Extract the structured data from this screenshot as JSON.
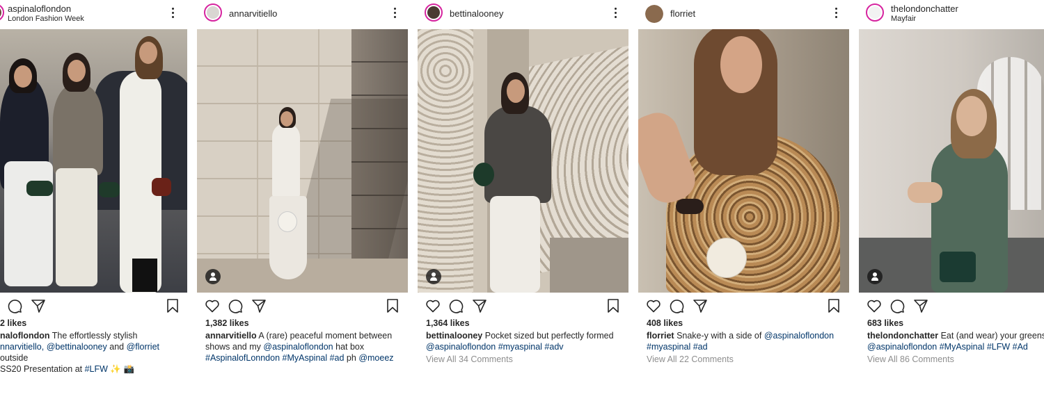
{
  "posts": [
    {
      "username": "aspinaloflondon",
      "location": "London Fashion Week",
      "likes": "2 likes",
      "caption_user": "naloflondon",
      "caption_parts": [
        {
          "t": " The effortlessly stylish",
          "link": false
        },
        {
          "t": "nnarvitiello, @bettinalooney",
          "link": true
        },
        {
          "t": " and ",
          "link": false
        },
        {
          "t": "@florriet",
          "link": true
        },
        {
          "t": " outside",
          "link": false
        },
        {
          "t": "SS20 Presentation at ",
          "link": false
        },
        {
          "t": "#LFW",
          "link": true
        },
        {
          "t": " ✨ 📸",
          "link": false
        }
      ],
      "comments": ""
    },
    {
      "username": "annarvitiello",
      "location": "",
      "likes": "1,382 likes",
      "caption_user": "annarvitiello",
      "caption_parts": [
        {
          "t": " A (rare) peaceful moment between shows and my ",
          "link": false
        },
        {
          "t": "@aspinaloflondon",
          "link": true
        },
        {
          "t": " hat box ",
          "link": false
        },
        {
          "t": "#AspinalofLonndon #MyAspinal #ad",
          "link": true
        },
        {
          "t": " ph ",
          "link": false
        },
        {
          "t": "@moeez",
          "link": true
        }
      ],
      "comments": ""
    },
    {
      "username": "bettinalooney",
      "location": "",
      "likes": "1,364 likes",
      "caption_user": "bettinalooney",
      "caption_parts": [
        {
          "t": " Pocket sized but perfectly formed ",
          "link": false
        },
        {
          "t": "@aspinaloflondon #myaspinal #adv",
          "link": true
        }
      ],
      "comments": "View All 34 Comments"
    },
    {
      "username": "florriet",
      "location": "",
      "likes": "408 likes",
      "caption_user": "florriet",
      "caption_parts": [
        {
          "t": " Snake-y with a side of ",
          "link": false
        },
        {
          "t": "@aspinaloflondon #myaspinal #ad",
          "link": true
        }
      ],
      "comments": "View All 22 Comments"
    },
    {
      "username": "thelondonchatter",
      "location": "Mayfair",
      "likes": "683 likes",
      "caption_user": "thelondonchatter",
      "caption_parts": [
        {
          "t": " Eat (and wear) your greens, kids",
          "link": false
        },
        {
          "t": "@aspinaloflondon #MyAspinal #LFW #Ad",
          "link": true
        }
      ],
      "comments": "View All 86 Comments"
    }
  ]
}
